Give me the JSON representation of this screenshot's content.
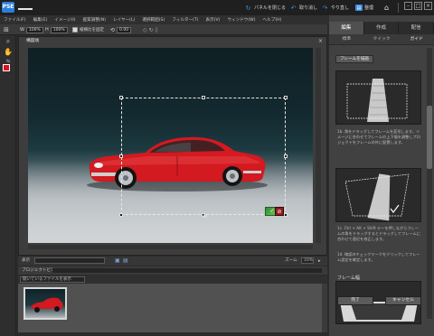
{
  "titlebar": {
    "logo": "PSE",
    "buttons": [
      {
        "label": "パネルを閉じる",
        "icon": "reset-panels-icon"
      },
      {
        "label": "取り消し",
        "icon": "undo-icon"
      },
      {
        "label": "やり直し",
        "icon": "redo-icon"
      },
      {
        "label": "整理",
        "icon": "organizer-icon"
      },
      {
        "label": "",
        "icon": "home-icon"
      }
    ]
  },
  "menubar": [
    "ファイル(F)",
    "編集(E)",
    "イメージ(I)",
    "画質調整(N)",
    "レイヤー(L)",
    "選択範囲(S)",
    "フィルター(T)",
    "表示(V)",
    "ウィンドウ(W)",
    "ヘルプ(H)"
  ],
  "options": {
    "width_value": "100%",
    "height_value": "100%",
    "constrain_label": "縦横比を固定",
    "angle_value": "0.00"
  },
  "document": {
    "title": "構図後"
  },
  "statusbar": {
    "display_label": "表示",
    "zoom_label": "ズーム",
    "zoom_value": "33%"
  },
  "project_bin": {
    "label": "プロジェクトビン",
    "dropdown": "開いているファイルを表示"
  },
  "panel": {
    "mode_tabs": [
      {
        "label": "編集",
        "active": true
      },
      {
        "label": "作成",
        "active": false
      },
      {
        "label": "配信",
        "active": false
      }
    ],
    "sub_tabs": [
      {
        "label": "標準",
        "active": false
      },
      {
        "label": "クイック",
        "active": false
      },
      {
        "label": "ガイド",
        "active": true
      }
    ],
    "frame_button": "フレームを描画",
    "step2": "1b. 角をドラッグしてフレームを変形します。イメージに合わせてフレームの上下幅を調整しプロジェクトをフレームの外に配置します。",
    "step3": "1c. Ctrl + Alt + Shift キーを押しながらフレームの角をドラッグするとドラッグしてフレームに合わせて遠近を修正します。",
    "step4": "1d. 確認のチェックマークをクリックしてフレーム設定を確定します。",
    "frame_width_label": "フレーム幅",
    "done_label": "完了",
    "cancel_label": "キャンセル"
  },
  "colors": {
    "accent": "#2b7fd9",
    "foreground": "#e0101c",
    "background": "#ffffff",
    "commit": "#4aa83c"
  }
}
